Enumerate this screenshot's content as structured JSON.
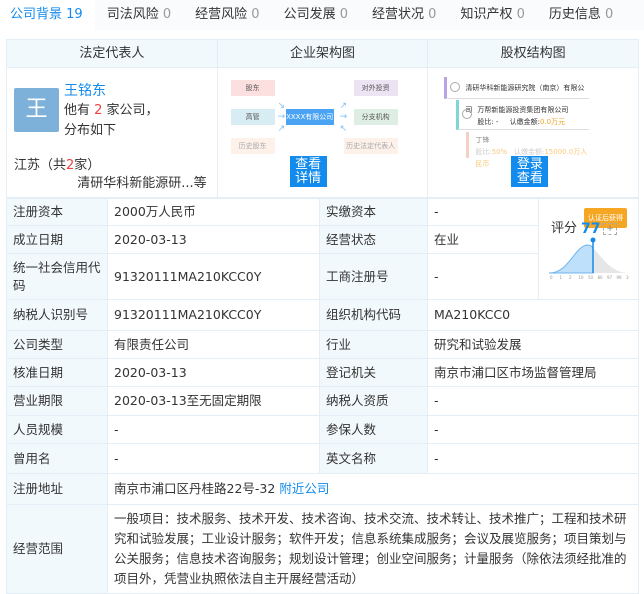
{
  "tabs": [
    {
      "label": "公司背景",
      "count": "19"
    },
    {
      "label": "司法风险",
      "count": "0"
    },
    {
      "label": "经营风险",
      "count": "0"
    },
    {
      "label": "公司发展",
      "count": "0"
    },
    {
      "label": "经营状况",
      "count": "0"
    },
    {
      "label": "知识产权",
      "count": "0"
    },
    {
      "label": "历史信息",
      "count": "0"
    }
  ],
  "top": {
    "headers": [
      "法定代表人",
      "企业架构图",
      "股权结构图"
    ],
    "legal": {
      "avatar": "王",
      "name": "王铭东",
      "desc_pre": "他有 ",
      "count": "2",
      "desc_post": " 家公司，分布如下",
      "prov_pre": "江苏（共",
      "prov_count": "2",
      "prov_post": "家）",
      "company": "清研华科新能源研...等"
    },
    "arch": {
      "boxes": [
        "股东",
        "高管",
        "历史股东",
        "XXXX有限公司",
        "对外投资",
        "分支机构",
        "历史法定代表人"
      ],
      "button": "查看详情"
    },
    "equity": {
      "company": "清研华科新能源研究院（南京）有限公司",
      "sub": "万帮新能源投资集团有限公司",
      "sub_ratio": "股比: -",
      "sub_amount_label": "认缴金额:",
      "sub_amount": "0.0万元",
      "person": "丁锋",
      "person_ratio_label": "股比:",
      "person_ratio": "50%",
      "person_amount_label": "认缴金额:",
      "person_amount": "15000.0万人民币",
      "button": "登录查看"
    }
  },
  "score": {
    "label": "评分",
    "value": "77",
    "badge": "认证后获得",
    "plus": "+",
    "ticks": [
      "0",
      "1",
      "2",
      "10",
      "50",
      "80",
      "97",
      "99",
      "100"
    ]
  },
  "rows": [
    [
      "注册资本",
      "2000万人民币",
      "实缴资本",
      "-"
    ],
    [
      "成立日期",
      "2020-03-13",
      "经营状态",
      "在业"
    ],
    [
      "统一社会信用代码",
      "91320111MA210KCC0Y",
      "工商注册号",
      "-"
    ],
    [
      "纳税人识别号",
      "91320111MA210KCC0Y",
      "组织机构代码",
      "MA210KCC0"
    ],
    [
      "公司类型",
      "有限责任公司",
      "行业",
      "研究和试验发展"
    ],
    [
      "核准日期",
      "2020-03-13",
      "登记机关",
      "南京市浦口区市场监督管理局"
    ],
    [
      "营业期限",
      "2020-03-13至无固定期限",
      "纳税人资质",
      "-"
    ],
    [
      "人员规模",
      "-",
      "参保人数",
      "-"
    ],
    [
      "曾用名",
      "-",
      "英文名称",
      "-"
    ]
  ],
  "address": {
    "label": "注册地址",
    "value": "南京市浦口区丹桂路22号-32",
    "link": "附近公司"
  },
  "scope": {
    "label": "经营范围",
    "value": "一般项目：技术服务、技术开发、技术咨询、技术交流、技术转让、技术推广；工程和技术研究和试验发展；工业设计服务；软件开发；信息系统集成服务；会议及展览服务；项目策划与公关服务；信息技术咨询服务；规划设计管理；创业空间服务；计量服务（除依法须经批准的项目外，凭营业执照依法自主开展经营活动）"
  }
}
